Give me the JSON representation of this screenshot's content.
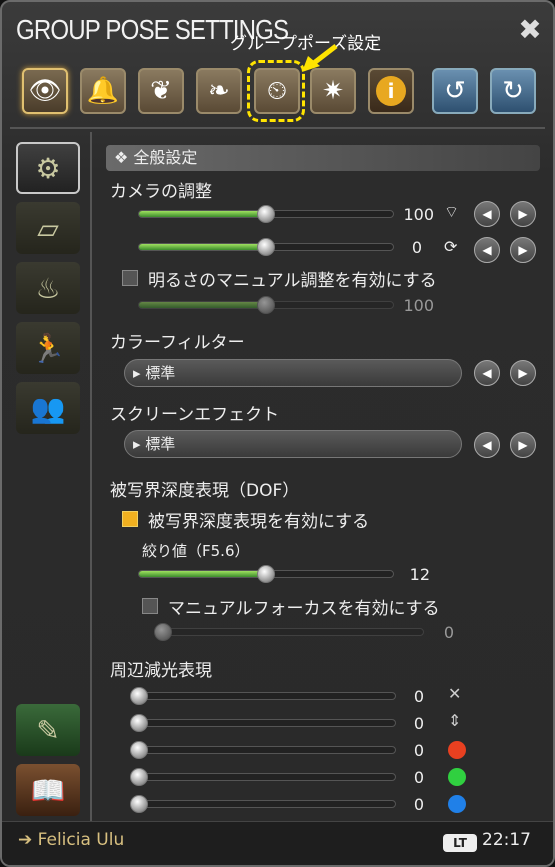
{
  "window": {
    "title": "GROUP POSE SETTINGS",
    "annotation": "グループポーズ設定"
  },
  "toolbar": [
    {
      "name": "eye-icon",
      "glyph": "👁"
    },
    {
      "name": "light-icon",
      "glyph": "🔔"
    },
    {
      "name": "tree-icon",
      "glyph": "❦"
    },
    {
      "name": "figure-tree-icon",
      "glyph": "❧"
    },
    {
      "name": "clock-sun-lock-icon",
      "glyph": "⏲"
    },
    {
      "name": "effect-icon",
      "glyph": "✷"
    },
    {
      "name": "info-icon",
      "glyph": "i"
    },
    {
      "name": "rotate-left-icon",
      "glyph": "↺"
    },
    {
      "name": "rotate-right-icon",
      "glyph": "↻"
    }
  ],
  "sidebar": [
    {
      "name": "camera-settings-icon",
      "glyph": "⚙"
    },
    {
      "name": "frame-icon",
      "glyph": "▱"
    },
    {
      "name": "light-icon",
      "glyph": "♨"
    },
    {
      "name": "running-figure-icon",
      "glyph": "🏃"
    },
    {
      "name": "group-figures-icon",
      "glyph": "👥"
    },
    {
      "name": "book-feather-icon",
      "glyph": "✎"
    },
    {
      "name": "book-light-icon",
      "glyph": "📖"
    }
  ],
  "section": {
    "header": "❖ 全般設定"
  },
  "camera": {
    "label": "カメラの調整",
    "slider1_value": "100",
    "slider2_value": "0",
    "brightness_manual_label": "明るさのマニュアル調整を有効にする",
    "brightness_value": "100"
  },
  "color_filter": {
    "label": "カラーフィルター",
    "value": "▸ 標準"
  },
  "screen_effect": {
    "label": "スクリーンエフェクト",
    "value": "▸ 標準"
  },
  "dof": {
    "label": "被写界深度表現（DOF）",
    "enable_label": "被写界深度表現を有効にする",
    "aperture_label": "絞り値（F5.6）",
    "aperture_value": "12",
    "manual_focus_label": "マニュアルフォーカスを有効にする",
    "focus_value": "0"
  },
  "vignette": {
    "label": "周辺減光表現",
    "values": [
      "0",
      "0",
      "0",
      "0",
      "0"
    ],
    "colors": [
      "",
      "",
      "#e84020",
      "#30d040",
      "#2080e8"
    ]
  },
  "footer": {
    "player": "➔ Felicia Ulu",
    "lt": "LT",
    "time": "22:17"
  },
  "levels": {
    "camera_slider1": 0.5,
    "camera_slider2": 0.5,
    "brightness": 0.5,
    "aperture": 0.5,
    "focus": 0.0,
    "vignette": [
      0,
      0,
      0,
      0,
      0
    ]
  }
}
